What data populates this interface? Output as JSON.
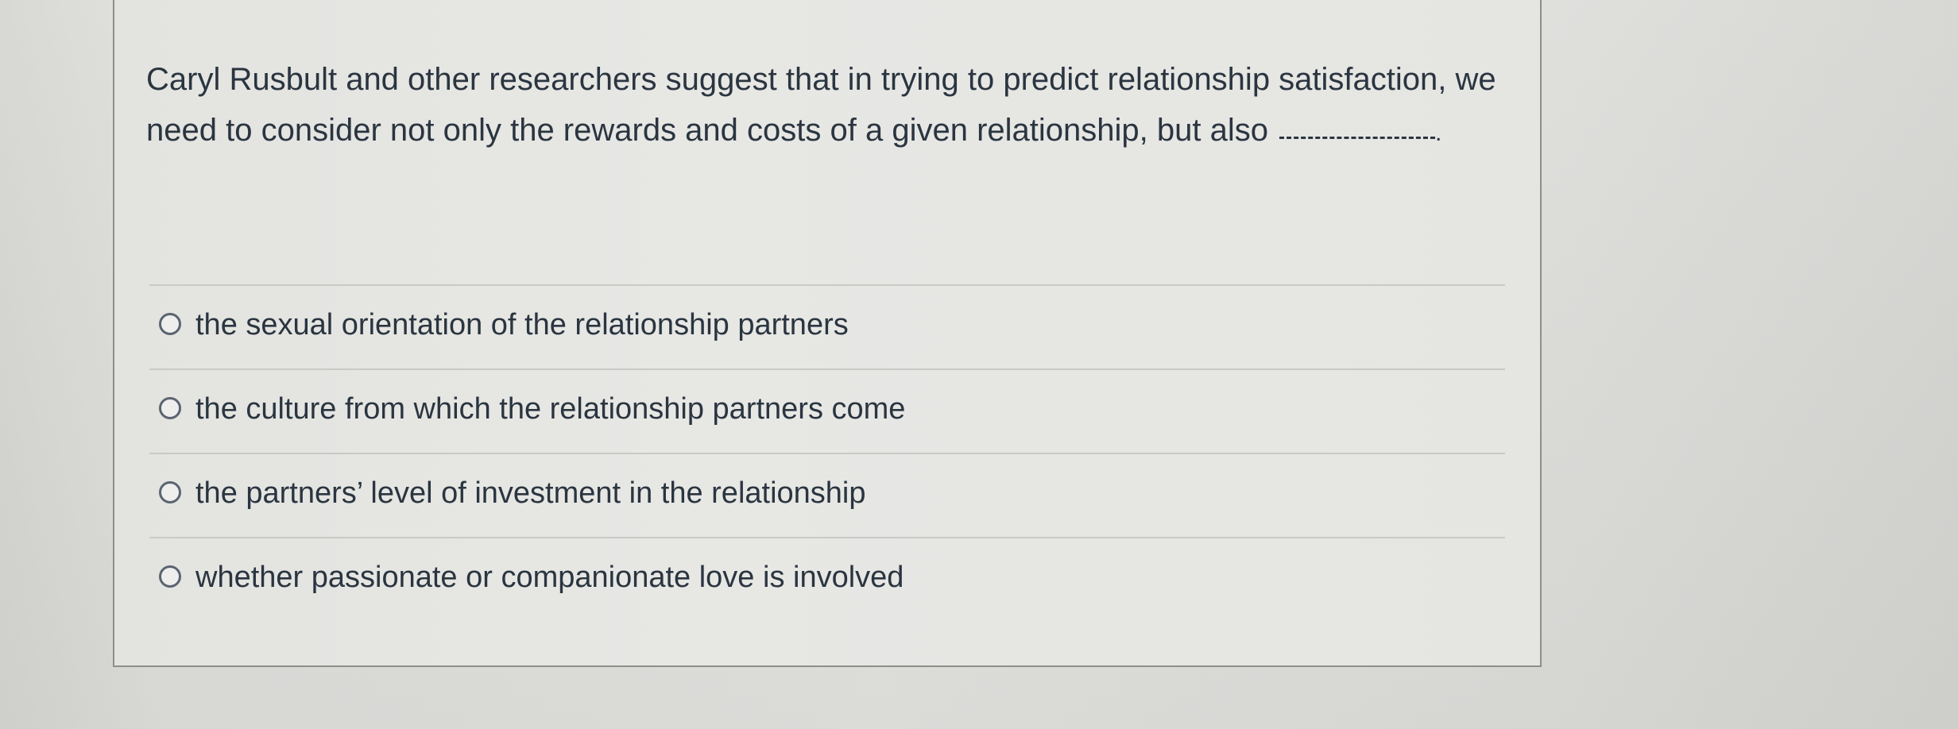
{
  "question": {
    "text": "Caryl Rusbult and other researchers suggest that in trying to predict relationship satisfaction, we need to consider not only the rewards and costs of a given relationship, but also",
    "blank_suffix": "."
  },
  "answers": [
    {
      "label": "the sexual orientation of the relationship partners",
      "selected": false
    },
    {
      "label": "the culture from which the relationship partners come",
      "selected": false
    },
    {
      "label": "the partners’ level of investment in the relationship",
      "selected": false
    },
    {
      "label": "whether passionate or companionate love is involved",
      "selected": false
    }
  ]
}
